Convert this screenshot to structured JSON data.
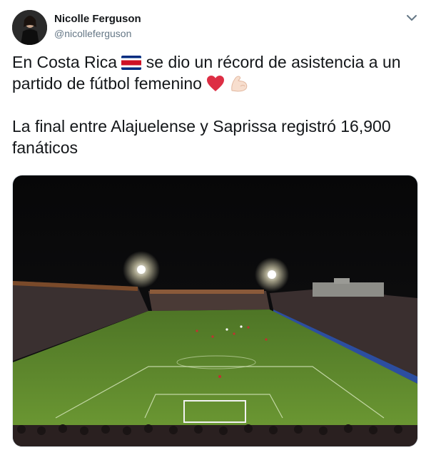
{
  "author": {
    "name": "Nicolle Ferguson",
    "handle": "@nicolleferguson"
  },
  "tweet": {
    "line1_a": "En Costa Rica",
    "line1_b": "se dio un récord de asistencia a un",
    "line2": "partido de fútbol femenino",
    "line3": "La final entre Alajuelense y Saprissa registró 16,900",
    "line4": "fanáticos"
  },
  "icons": {
    "flag": "costa-rica-flag-icon",
    "heart": "red-heart-icon",
    "muscle": "flexed-biceps-icon",
    "menu": "chevron-down-icon"
  },
  "colors": {
    "text": "#14171a",
    "secondary": "#657786",
    "pitch": "#5e8a2c",
    "sky": "#0b0b0e"
  }
}
